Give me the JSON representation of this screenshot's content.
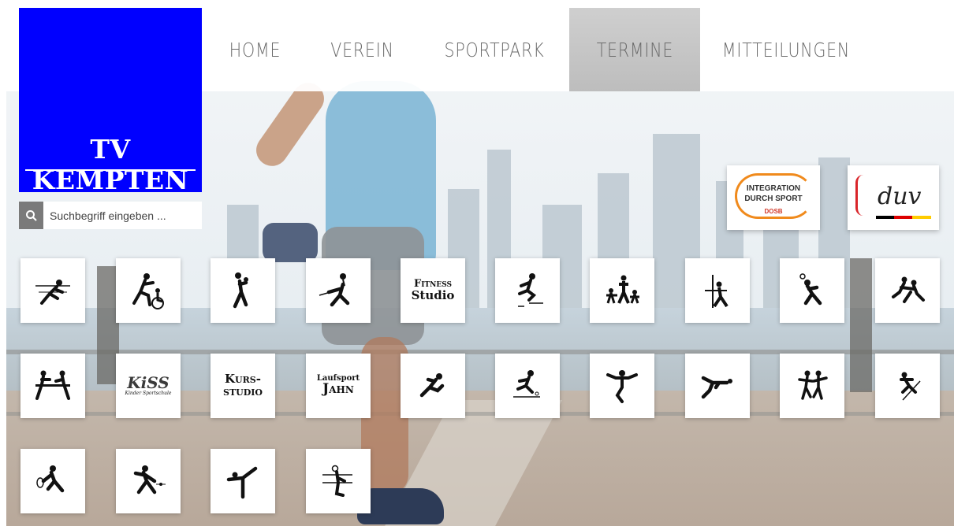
{
  "brand": {
    "name": "TV Kempten",
    "logo_text": "TV KEMPTEN",
    "color": "#0000ff"
  },
  "nav": {
    "items": [
      {
        "label": "HOME"
      },
      {
        "label": "VEREIN"
      },
      {
        "label": "SPORTPARK"
      },
      {
        "label": "TERMINE",
        "active": true
      },
      {
        "label": "MITTEILUNGEN"
      }
    ]
  },
  "search": {
    "placeholder": "Suchbegriff eingeben ...",
    "icon": "search-icon"
  },
  "partners": {
    "integration": {
      "line1": "INTEGRATION",
      "line2": "DURCH SPORT",
      "line3": "DOSB"
    },
    "duv": {
      "text": "duv"
    }
  },
  "tiles": {
    "fitness": [
      "Fitness",
      "Studio"
    ],
    "kursstudio": [
      "Kurs-",
      "studio"
    ],
    "laufsport": [
      "Laufsport",
      "Jahn"
    ],
    "kiss": [
      "KiSS",
      "Kinder Sportschule"
    ]
  },
  "icons": [
    "badminton-icon",
    "wheelchair-sports-icon",
    "basketball-icon",
    "fencing-icon",
    "fitness-studio-logo",
    "hurdles-icon",
    "ballroom-dance-icon",
    "gymnastics-icon",
    "handball-icon",
    "judo-icon",
    "table-tennis-icon",
    "kiss-logo",
    "kursstudio-logo",
    "laufsport-jahn-logo",
    "running-icon",
    "athletics-hurdle-icon",
    "trampoline-icon",
    "jump-icon",
    "dance-icon",
    "skiing-icon",
    "tennis-icon",
    "squash-icon",
    "gymnastics-beam-icon",
    "climbing-icon"
  ]
}
